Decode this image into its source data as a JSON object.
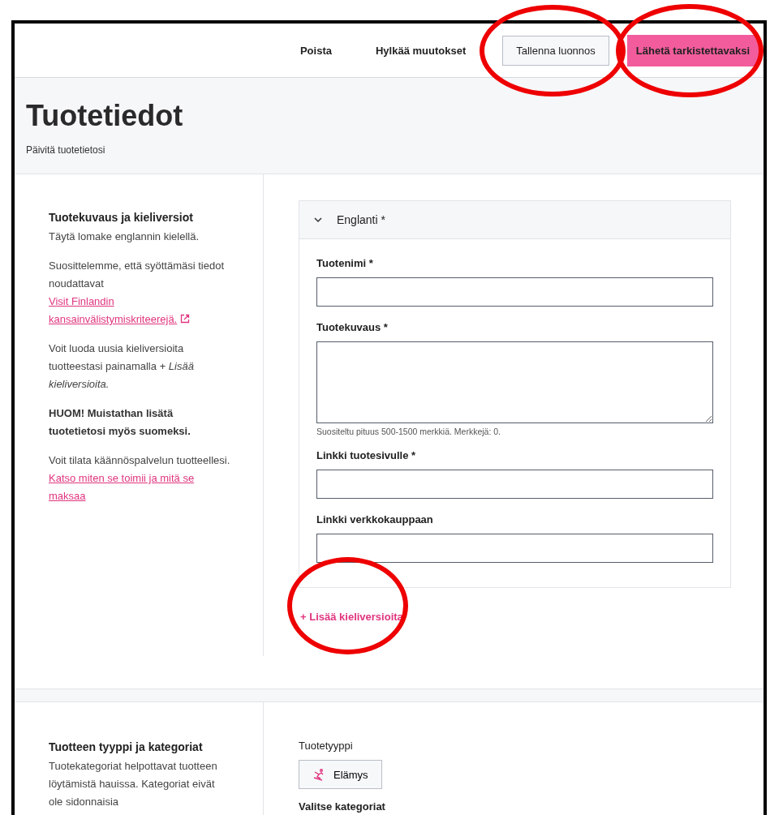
{
  "header": {
    "buttons": [
      {
        "label": "Poista",
        "kind": "text",
        "circled": false
      },
      {
        "label": "Hylkää muutokset",
        "kind": "text",
        "circled": false
      },
      {
        "label": "Tallenna luonnos",
        "kind": "outline",
        "circled": true
      },
      {
        "label": "Lähetä tarkistettavaksi",
        "kind": "primary",
        "circled": true
      }
    ]
  },
  "page": {
    "title": "Tuotetiedot",
    "subtitle": "Päivitä tuotetietosi"
  },
  "description_section": {
    "heading": "Tuotekuvaus ja kieliversiot",
    "paragraphs": [
      {
        "kind": "plain",
        "text": "Täytä lomake englannin kielellä."
      },
      {
        "kind": "link",
        "text": "Suosittelemme, että syöttämäsi tiedot noudattavat ",
        "link": "Visit Finlandin kansainvälistymiskriteerejä.",
        "external": true
      },
      {
        "kind": "plain",
        "text": "Voit luoda uusia kieliversioita tuotteestasi painamalla *+ Lisää kieliversioita.*"
      },
      {
        "kind": "bold",
        "text": "HUOM! Muistathan lisätä tuotetietosi myös suomeksi."
      },
      {
        "kind": "link",
        "text": "Voit tilata käännöspalvelun tuotteellesi. ",
        "link": "Katso miten se toimii ja mitä se maksaa",
        "external": false
      }
    ],
    "language_panel": {
      "title": "Englanti *",
      "expanded": true,
      "fields": [
        {
          "label": "Tuotenimi *",
          "kind": "input"
        },
        {
          "label": "Tuotekuvaus *",
          "kind": "textarea",
          "hint": "Suositeltu pituus 500-1500 merkkiä. Merkkejä: 0."
        },
        {
          "label": "Linkki tuotesivulle *",
          "kind": "input"
        },
        {
          "label": "Linkki verkkokauppaan",
          "kind": "input"
        }
      ]
    },
    "add_language": {
      "label": "+ Lisää kieliversioita",
      "circled": true
    }
  },
  "type_section": {
    "heading": "Tuotteen tyyppi ja kategoriat",
    "text": "Tuotekategoriat helpottavat tuotteen löytämistä hauissa. Kategoriat eivät ole sidonnaisia",
    "type_label": "Tuotetyyppi",
    "type_button": "Elämys",
    "categories_label": "Valitse kategoriat"
  }
}
